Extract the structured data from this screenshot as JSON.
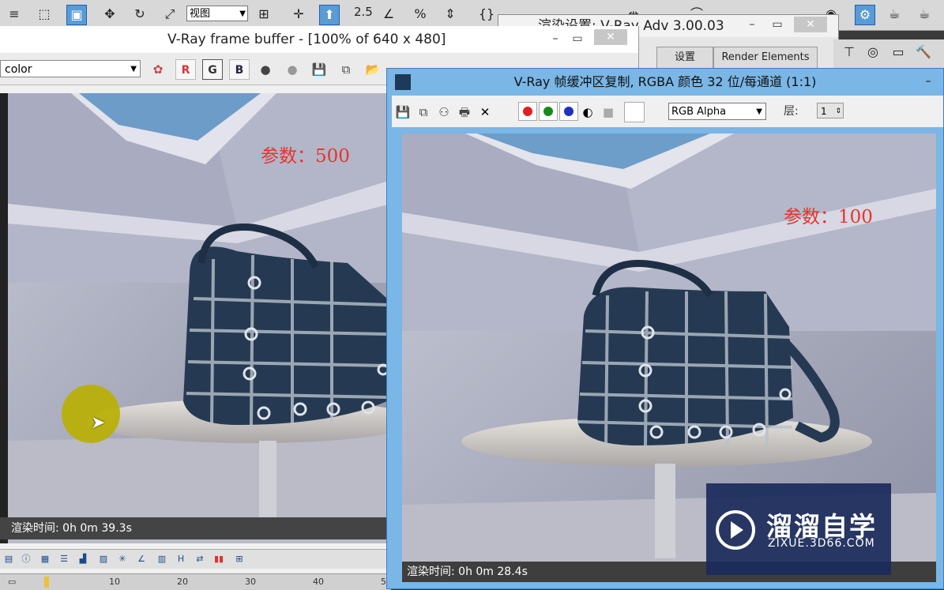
{
  "max_toolbar": {
    "view_select": "视图",
    "snap_value": "2.5",
    "icons": [
      "select-list-icon",
      "region-select-icon",
      "window-crossing-icon",
      "move-icon",
      "rotate-icon",
      "scale-icon",
      "view-dropdown",
      "pivot-icon",
      "align-icon",
      "snap-icon",
      "angle-snap-icon",
      "percent-snap-icon",
      "spinner-snap-icon",
      "named-selection-icon"
    ]
  },
  "render_settings": {
    "title": "渲染设置: V-Ray Adv 3.00.03",
    "tabs": [
      "设置",
      "Render Elements"
    ]
  },
  "vfb_main": {
    "title": "V-Ray frame buffer - [100% of 640 x 480]",
    "channel": "color",
    "channel_buttons": [
      "R",
      "G",
      "B"
    ],
    "param_label": "参数：500",
    "status": "渲染时间: 0h  0m 39.3s",
    "timeline_ticks": [
      "10",
      "20",
      "30",
      "40",
      "5"
    ]
  },
  "vfb_copy": {
    "title": "V-Ray 帧缓冲区复制, RGBA 颜色 32 位/每通道 (1:1)",
    "channel_mode": "RGB Alpha",
    "layer_label": "层:",
    "layer_value": "1",
    "param_label": "参数：100",
    "status": "渲染时间: 0h  0m 28.4s"
  },
  "watermark": {
    "cn": "溜溜自学",
    "en": "ZIXUE.3D66.COM"
  },
  "colors": {
    "accent": "#5b9bd5",
    "copy_window_frame": "#7ab6e6",
    "param_red": "#e8332a"
  }
}
